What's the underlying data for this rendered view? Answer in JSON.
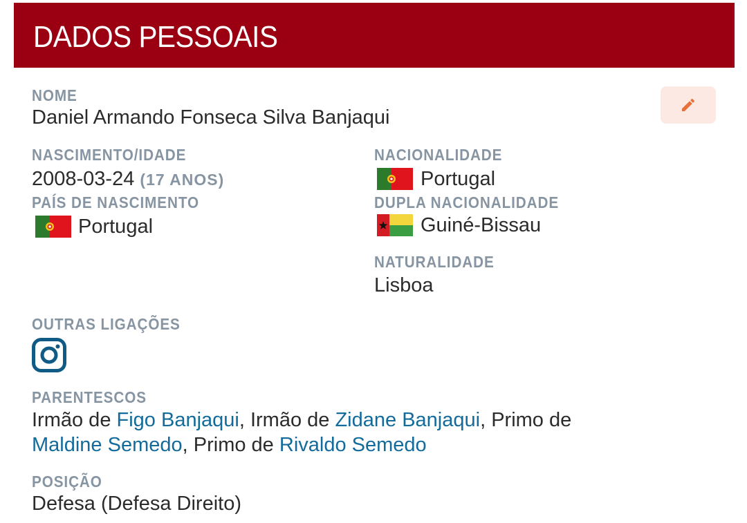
{
  "header": {
    "title": "DADOS PESSOAIS"
  },
  "edit_button": {
    "icon": "pencil-icon",
    "color": "#e8703a"
  },
  "nome": {
    "label": "NOME",
    "value": "Daniel Armando Fonseca Silva Banjaqui"
  },
  "nascimento": {
    "label": "NASCIMENTO/IDADE",
    "date": "2008-03-24",
    "age": "(17 ANOS)"
  },
  "pais_nascimento": {
    "label": "PAÍS DE NASCIMENTO",
    "value": "Portugal",
    "flag": "portugal-flag"
  },
  "nacionalidade": {
    "label": "NACIONALIDADE",
    "value": "Portugal",
    "flag": "portugal-flag"
  },
  "dupla_nacionalidade": {
    "label": "DUPLA NACIONALIDADE",
    "value": "Guiné-Bissau",
    "flag": "guinea-bissau-flag"
  },
  "naturalidade": {
    "label": "NATURALIDADE",
    "value": "Lisboa"
  },
  "outras_ligacoes": {
    "label": "OUTRAS LIGAÇÕES",
    "icon": "instagram-icon"
  },
  "parentescos": {
    "label": "PARENTESCOS",
    "items": [
      {
        "prefix": "Irmão de ",
        "name": "Figo Banjaqui",
        "sep": ", "
      },
      {
        "prefix": "Irmão de ",
        "name": "Zidane Banjaqui",
        "sep": ", "
      },
      {
        "prefix": "Primo de ",
        "name": "Maldine Semedo",
        "sep": ", "
      },
      {
        "prefix": "Primo de ",
        "name": "Rivaldo Semedo",
        "sep": ""
      }
    ]
  },
  "posicao": {
    "label": "POSIÇÃO",
    "value": "Defesa (Defesa Direito)"
  },
  "colors": {
    "header_bg": "#9a0012",
    "label": "#8795a3",
    "link": "#136b9c",
    "edit_bg": "#fde9e3"
  }
}
